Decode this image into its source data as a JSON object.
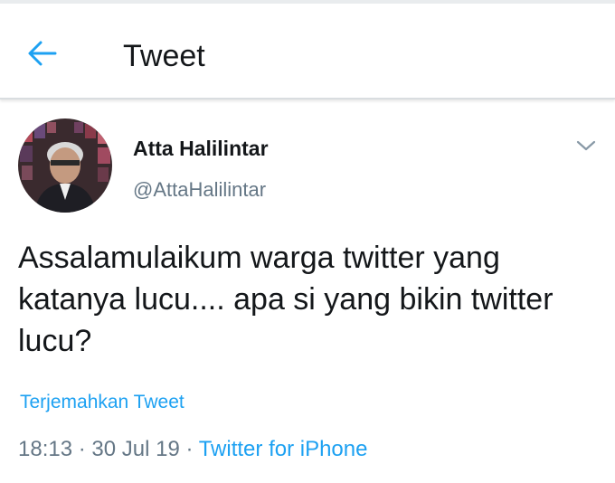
{
  "header": {
    "back_icon": "arrow-left-icon",
    "title": "Tweet"
  },
  "tweet": {
    "author": {
      "name": "Atta Halilintar",
      "handle": "@AttaHalilintar"
    },
    "more_icon": "chevron-down-icon",
    "text": "Assalamulaikum warga twitter yang katanya lucu.... apa si yang bikin twitter lucu?",
    "translate_label": "Terjemahkan Tweet",
    "time": "18:13",
    "separator": "·",
    "date": "30 Jul 19",
    "source": "Twitter for iPhone"
  },
  "colors": {
    "accent": "#1da1f2",
    "secondary_text": "#657786",
    "primary_text": "#14171a"
  }
}
